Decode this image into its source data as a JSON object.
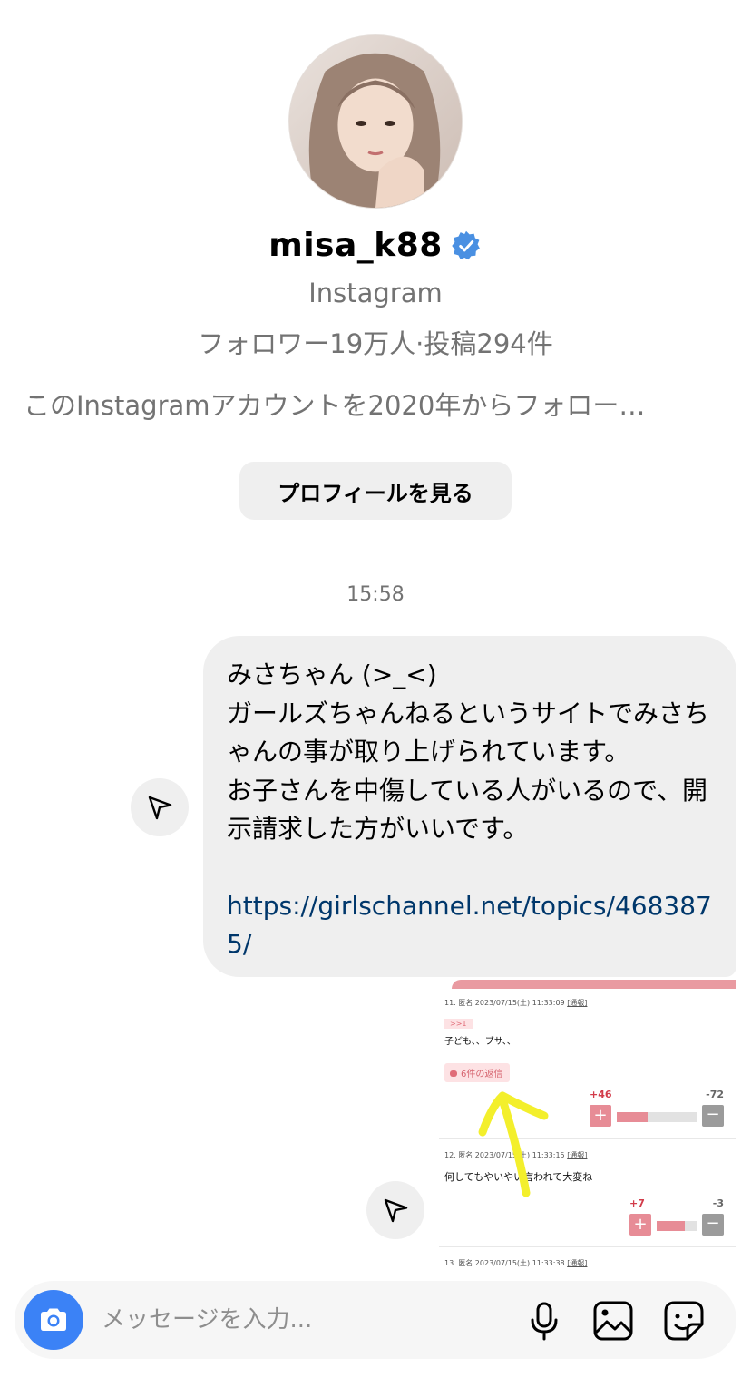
{
  "profile": {
    "username": "misa_k88",
    "source": "Instagram",
    "stats": "フォロワー19万人·投稿294件",
    "follow_since": "このInstagramアカウントを2020年からフォロー…",
    "view_profile_label": "プロフィールを見る"
  },
  "chat": {
    "timestamp": "15:58",
    "message_text": "みさちゃん (>_<)\nガールズちゃんねるというサイトでみさちゃんの事が取り上げられています。\nお子さんを中傷している人がいるので、開示請求した方がいいです。",
    "message_link": "https://girlschannel.net/topics/4683875/"
  },
  "screenshot": {
    "posts": [
      {
        "header": "11. 匿名 2023/07/15(土) 11:33:09",
        "report": "[通報]",
        "anchor": ">>1",
        "body": "子ども、、ブサ、、",
        "replies": "6件の返信",
        "plus": "+46",
        "minus": "-72",
        "plus_ratio": 0.39
      },
      {
        "header": "12. 匿名 2023/07/15(土) 11:33:15",
        "report": "[通報]",
        "body": "何してもやいやい言われて大変ね",
        "plus": "+7",
        "minus": "-3",
        "plus_ratio": 0.7
      },
      {
        "header": "13. 匿名 2023/07/15(土) 11:33:38",
        "report": "[通報]"
      }
    ]
  },
  "composer": {
    "placeholder": "メッセージを入力..."
  },
  "icons": {
    "verified": "verified-badge-icon",
    "share": "paper-plane-icon",
    "camera": "camera-icon",
    "mic": "microphone-icon",
    "gallery": "gallery-icon",
    "sticker": "sticker-icon"
  },
  "colors": {
    "verified_blue": "#4a90e2",
    "link": "#00376b",
    "camera_blue": "#3b82f6"
  }
}
